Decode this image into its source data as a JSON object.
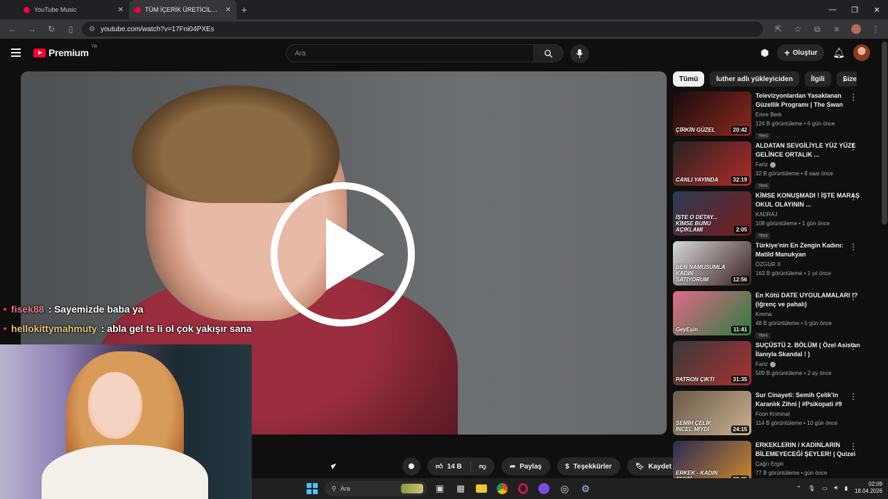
{
  "browser": {
    "tabs": [
      {
        "title": "YouTube Music",
        "active": false
      },
      {
        "title": "TÜM İÇERİK ÜRETİCİLERİNİ KAN",
        "active": true
      }
    ],
    "url": "youtube.com/watch?v=17Fni04PXEs"
  },
  "header": {
    "logo_text": "Premium",
    "logo_superscript": "TR",
    "search_placeholder": "Ara",
    "create_label": "Oluştur"
  },
  "chat": [
    {
      "user": "fisek88",
      "message": ": Sayemizde baba ya"
    },
    {
      "user": "hellokittymahmuty",
      "message": ": abla gel ts li ol çok yakışır sana"
    }
  ],
  "actions": {
    "like_count": "14 B",
    "share_label": "Paylaş",
    "thanks_label": "Teşekkürler",
    "save_label": "Kaydet"
  },
  "chips": [
    "Tümü",
    "luther adlı yükleyiciden",
    "İlgili",
    "Size ö"
  ],
  "recommendations": [
    {
      "title": "Televizyonlardan Yasaklanan Güzellik Programı | The Swan",
      "channel": "Emre Berk",
      "verified": false,
      "views": "124 B görüntüleme",
      "age": "6 gün önce",
      "badge": "Yeni",
      "duration": "20:42",
      "thumb_text": "ÇİRKİN        GÜZEL",
      "colors": [
        "#1a0b0b",
        "#8a2a20"
      ]
    },
    {
      "title": "ALDATAN SEVGİLİYLE YÜZ YÜZE GELİNCE ORTALIK ...",
      "channel": "Fariz",
      "verified": true,
      "views": "32 B görüntüleme",
      "age": "8 saat önce",
      "badge": "Yeni",
      "duration": "32:19",
      "thumb_text": "CANLI YAYINDA",
      "colors": [
        "#2a2320",
        "#b02a2a"
      ]
    },
    {
      "title": "KİMSE KONUŞMADI ! İŞTE MARAŞ OKUL OLAYININ ...",
      "channel": "KADRAJ",
      "verified": false,
      "views": "108 görüntüleme",
      "age": "1 gün önce",
      "badge": "Yeni",
      "duration": "2:05",
      "thumb_text": "İŞTE O DETAY... KİMSE BUNU AÇIKLAMI",
      "colors": [
        "#2b3b55",
        "#7a1b1b"
      ]
    },
    {
      "title": "Türkiye'nin En Zengin Kadını: Matild Manukyan",
      "channel": "ÖZGÜR X",
      "verified": false,
      "views": "163 B görüntüleme",
      "age": "1 yıl önce",
      "badge": "",
      "duration": "12:56",
      "thumb_text": "BEN NAMUSUMLA KADIN SATIYORUM",
      "colors": [
        "#d8d8d8",
        "#3a1f1f"
      ]
    },
    {
      "title": "En Kötü DATE UYGULAMALARI !? (iğrenç ve pahalı)",
      "channel": "Krema",
      "verified": false,
      "views": "48 B görüntüleme",
      "age": "5 gün önce",
      "badge": "Yeni",
      "duration": "11:41",
      "thumb_text": "GeyEşin",
      "colors": [
        "#e06a8a",
        "#2e7d3e"
      ]
    },
    {
      "title": "SUÇÜSTÜ 2. BÖLÜM ( Özel Asistan İlanıyla Skandal ! )",
      "channel": "Fariz",
      "verified": true,
      "views": "509 B görüntüleme",
      "age": "2 ay önce",
      "badge": "",
      "duration": "31:35",
      "thumb_text": "PATRON ÇIKTI",
      "colors": [
        "#3a3a3a",
        "#a83030"
      ]
    },
    {
      "title": "Sur Cinayeti: Semih Çelik'in Karanlık Zihni | #Psikopati #9",
      "channel": "Foon Kriminal",
      "verified": false,
      "views": "114 B görüntüleme",
      "age": "10 gün önce",
      "badge": "",
      "duration": "24:15",
      "thumb_text": "SEMİH ÇELİK İNCEL MİYDİ",
      "colors": [
        "#6b5a48",
        "#c9b090"
      ]
    },
    {
      "title": "ERKEKLERIN / KADINLARIN BİLEMEYECEĞİ ŞEYLER! | Quizei",
      "channel": "Çağrı Ergin",
      "verified": false,
      "views": "77 B görüntüleme",
      "age": "gün önce",
      "badge": "",
      "duration": "29:25",
      "thumb_text": "ERKEK - KADIN TESTİ",
      "colors": [
        "#2a2a55",
        "#d08a2a"
      ]
    }
  ],
  "taskbar": {
    "search_placeholder": "Ara",
    "time": "02:09",
    "date": "18.04.2026"
  }
}
